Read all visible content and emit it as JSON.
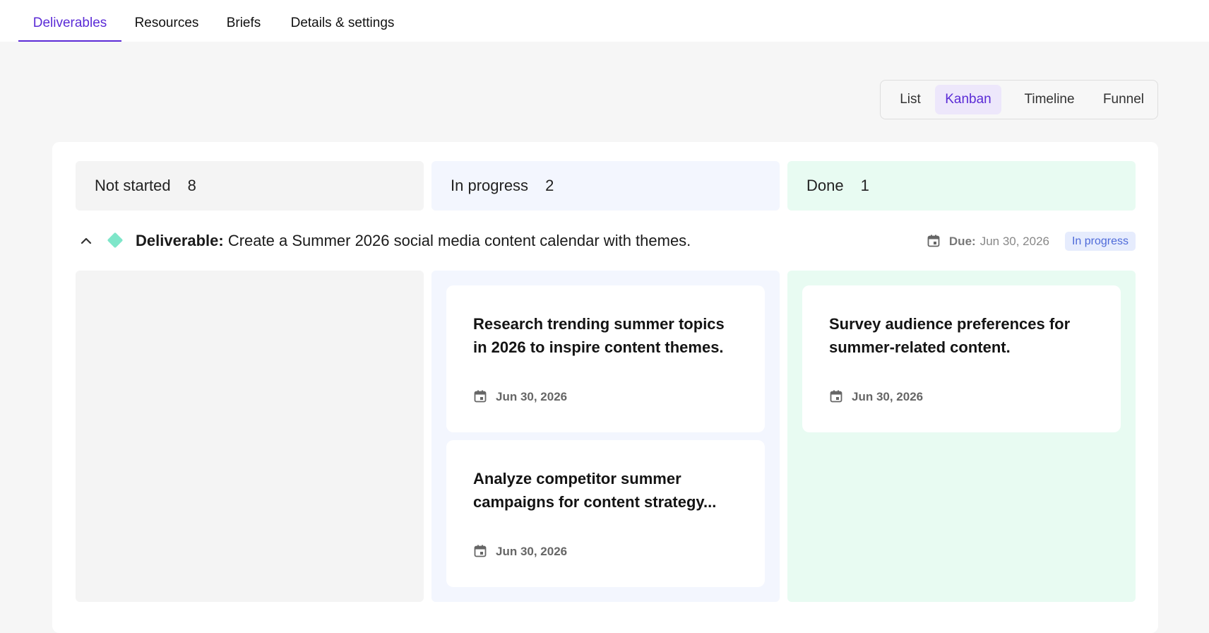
{
  "tabs": [
    {
      "label": "Deliverables",
      "active": true
    },
    {
      "label": "Resources"
    },
    {
      "label": "Briefs"
    },
    {
      "label": "Details & settings"
    }
  ],
  "view_switch": {
    "options": [
      "List",
      "Kanban",
      "Timeline",
      "Funnel"
    ],
    "selected": "Kanban"
  },
  "columns": [
    {
      "label": "Not started",
      "count": "8"
    },
    {
      "label": "In progress",
      "count": "2"
    },
    {
      "label": "Done",
      "count": "1"
    }
  ],
  "group": {
    "prefix": "Deliverable:",
    "title": " Create a Summer 2026 social media content calendar with themes.",
    "due_label": "Due:",
    "due_date": "Jun 30, 2026",
    "status": "In progress"
  },
  "cards": {
    "in_progress": [
      {
        "title": "Research trending summer topics in 2026 to inspire content themes.",
        "date": "Jun 30, 2026"
      },
      {
        "title": "Analyze competitor summer campaigns for content strategy...",
        "date": "Jun 30, 2026"
      }
    ],
    "done": [
      {
        "title": "Survey audience preferences for summer-related content.",
        "date": "Jun 30, 2026"
      }
    ]
  },
  "colors": {
    "accent": "#5b2bd6",
    "in_progress_bg": "#f3f6fe",
    "done_bg": "#e8fbf2",
    "diamond": "#7ee6c9"
  },
  "icons": [
    "calendar-icon",
    "chevron-up-icon",
    "diamond-icon"
  ]
}
